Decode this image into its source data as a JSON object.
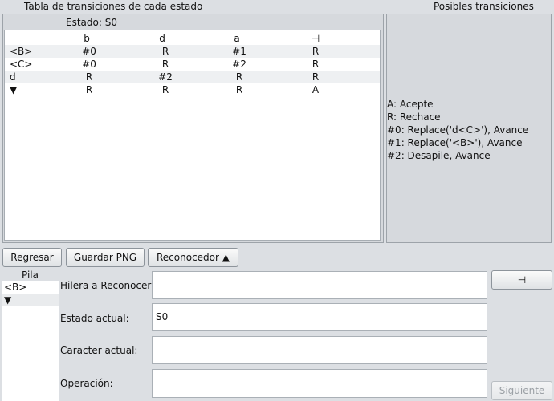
{
  "transition_table": {
    "title": "Tabla de transiciones de cada estado",
    "state_label": "Estado: S0",
    "columns": [
      "",
      "b",
      "d",
      "a",
      "⊣"
    ],
    "rows": [
      [
        "<B>",
        "#0",
        "R",
        "#1",
        "R"
      ],
      [
        "<C>",
        "#0",
        "R",
        "#2",
        "R"
      ],
      [
        "d",
        "R",
        "#2",
        "R",
        "R"
      ],
      [
        "▼",
        "R",
        "R",
        "R",
        "A"
      ]
    ]
  },
  "possible_transitions": {
    "title": "Posibles transiciones",
    "items": [
      "A: Acepte",
      "R: Rechace",
      "#0: Replace('d<C>'), Avance",
      "#1: Replace('<B>'), Avance",
      "#2: Desapile, Avance"
    ]
  },
  "toolbar": {
    "back_label": "Regresar",
    "save_png_label": "Guardar PNG",
    "recognizer_label": "Reconocedor ▲"
  },
  "stack": {
    "title": "Pila",
    "items": [
      "<B>",
      "▼"
    ]
  },
  "form": {
    "string_label": "Hilera a Reconocer:",
    "string_value": "",
    "state_label": "Estado actual:",
    "state_value": "S0",
    "char_label": "Caracter actual:",
    "char_value": "",
    "operation_label": "Operación:",
    "operation_value": "",
    "end_marker_button": "⊣",
    "next_button": "Siguiente"
  }
}
